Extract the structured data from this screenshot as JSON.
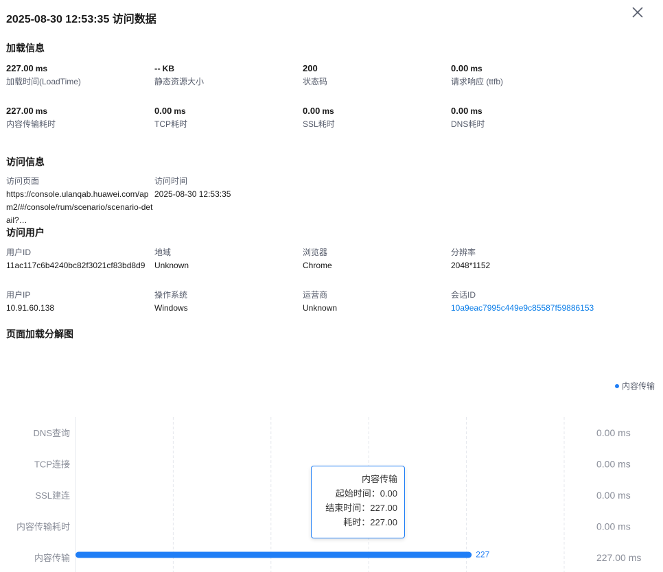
{
  "header": {
    "title": "2025-08-30 12:53:35 访问数据"
  },
  "load_info": {
    "title": "加载信息",
    "metrics": [
      {
        "value": "227.00",
        "unit": "ms",
        "label": "加载时间(LoadTime)"
      },
      {
        "value": "--",
        "unit": "KB",
        "label": "静态资源大小"
      },
      {
        "value": "200",
        "unit": "",
        "label": "状态码"
      },
      {
        "value": "0.00",
        "unit": "ms",
        "label": "请求响应 (ttfb)"
      },
      {
        "value": "227.00",
        "unit": "ms",
        "label": "内容传输耗时"
      },
      {
        "value": "0.00",
        "unit": "ms",
        "label": "TCP耗时"
      },
      {
        "value": "0.00",
        "unit": "ms",
        "label": "SSL耗时"
      },
      {
        "value": "0.00",
        "unit": "ms",
        "label": "DNS耗时"
      }
    ]
  },
  "visit_info": {
    "title": "访问信息",
    "page_label": "访问页面",
    "page_value": "https://console.ulanqab.huawei.com/apm2/#/console/rum/scenario/scenario-detail?…",
    "time_label": "访问时间",
    "time_value": "2025-08-30 12:53:35"
  },
  "visit_user": {
    "title": "访问用户",
    "fields": [
      {
        "label": "用户ID",
        "value": "11ac117c6b4240bc82f3021cf83bd8d9"
      },
      {
        "label": "地域",
        "value": "Unknown"
      },
      {
        "label": "浏览器",
        "value": "Chrome"
      },
      {
        "label": "分辨率",
        "value": "2048*1152"
      },
      {
        "label": "用户IP",
        "value": "10.91.60.138"
      },
      {
        "label": "操作系统",
        "value": "Windows"
      },
      {
        "label": "运营商",
        "value": "Unknown"
      },
      {
        "label": "会话ID",
        "value": "10a9eac7995c449e9c85587f59886153"
      }
    ]
  },
  "breakdown": {
    "title": "页面加载分解图",
    "legend": "内容传输",
    "tooltip": {
      "title": "内容传输",
      "start": "起始时间：0.00",
      "end": "结束时间：227.00",
      "duration": "耗时：227.00"
    }
  },
  "chart_data": {
    "type": "bar",
    "orientation": "horizontal",
    "categories": [
      "DNS查询",
      "TCP连接",
      "SSL建连",
      "内容传输耗时",
      "内容传输"
    ],
    "series": [
      {
        "name": "内容传输",
        "color": "#1f7ef6",
        "start": [
          null,
          null,
          null,
          null,
          0
        ],
        "end": [
          null,
          null,
          null,
          null,
          227
        ],
        "labels": [
          "",
          "",
          "",
          "",
          "227"
        ]
      }
    ],
    "right_labels": [
      "0.00 ms",
      "0.00 ms",
      "0.00 ms",
      "0.00 ms",
      "227.00 ms"
    ],
    "xlim": [
      0,
      280
    ],
    "grid": true,
    "legend_position": "top-right"
  }
}
